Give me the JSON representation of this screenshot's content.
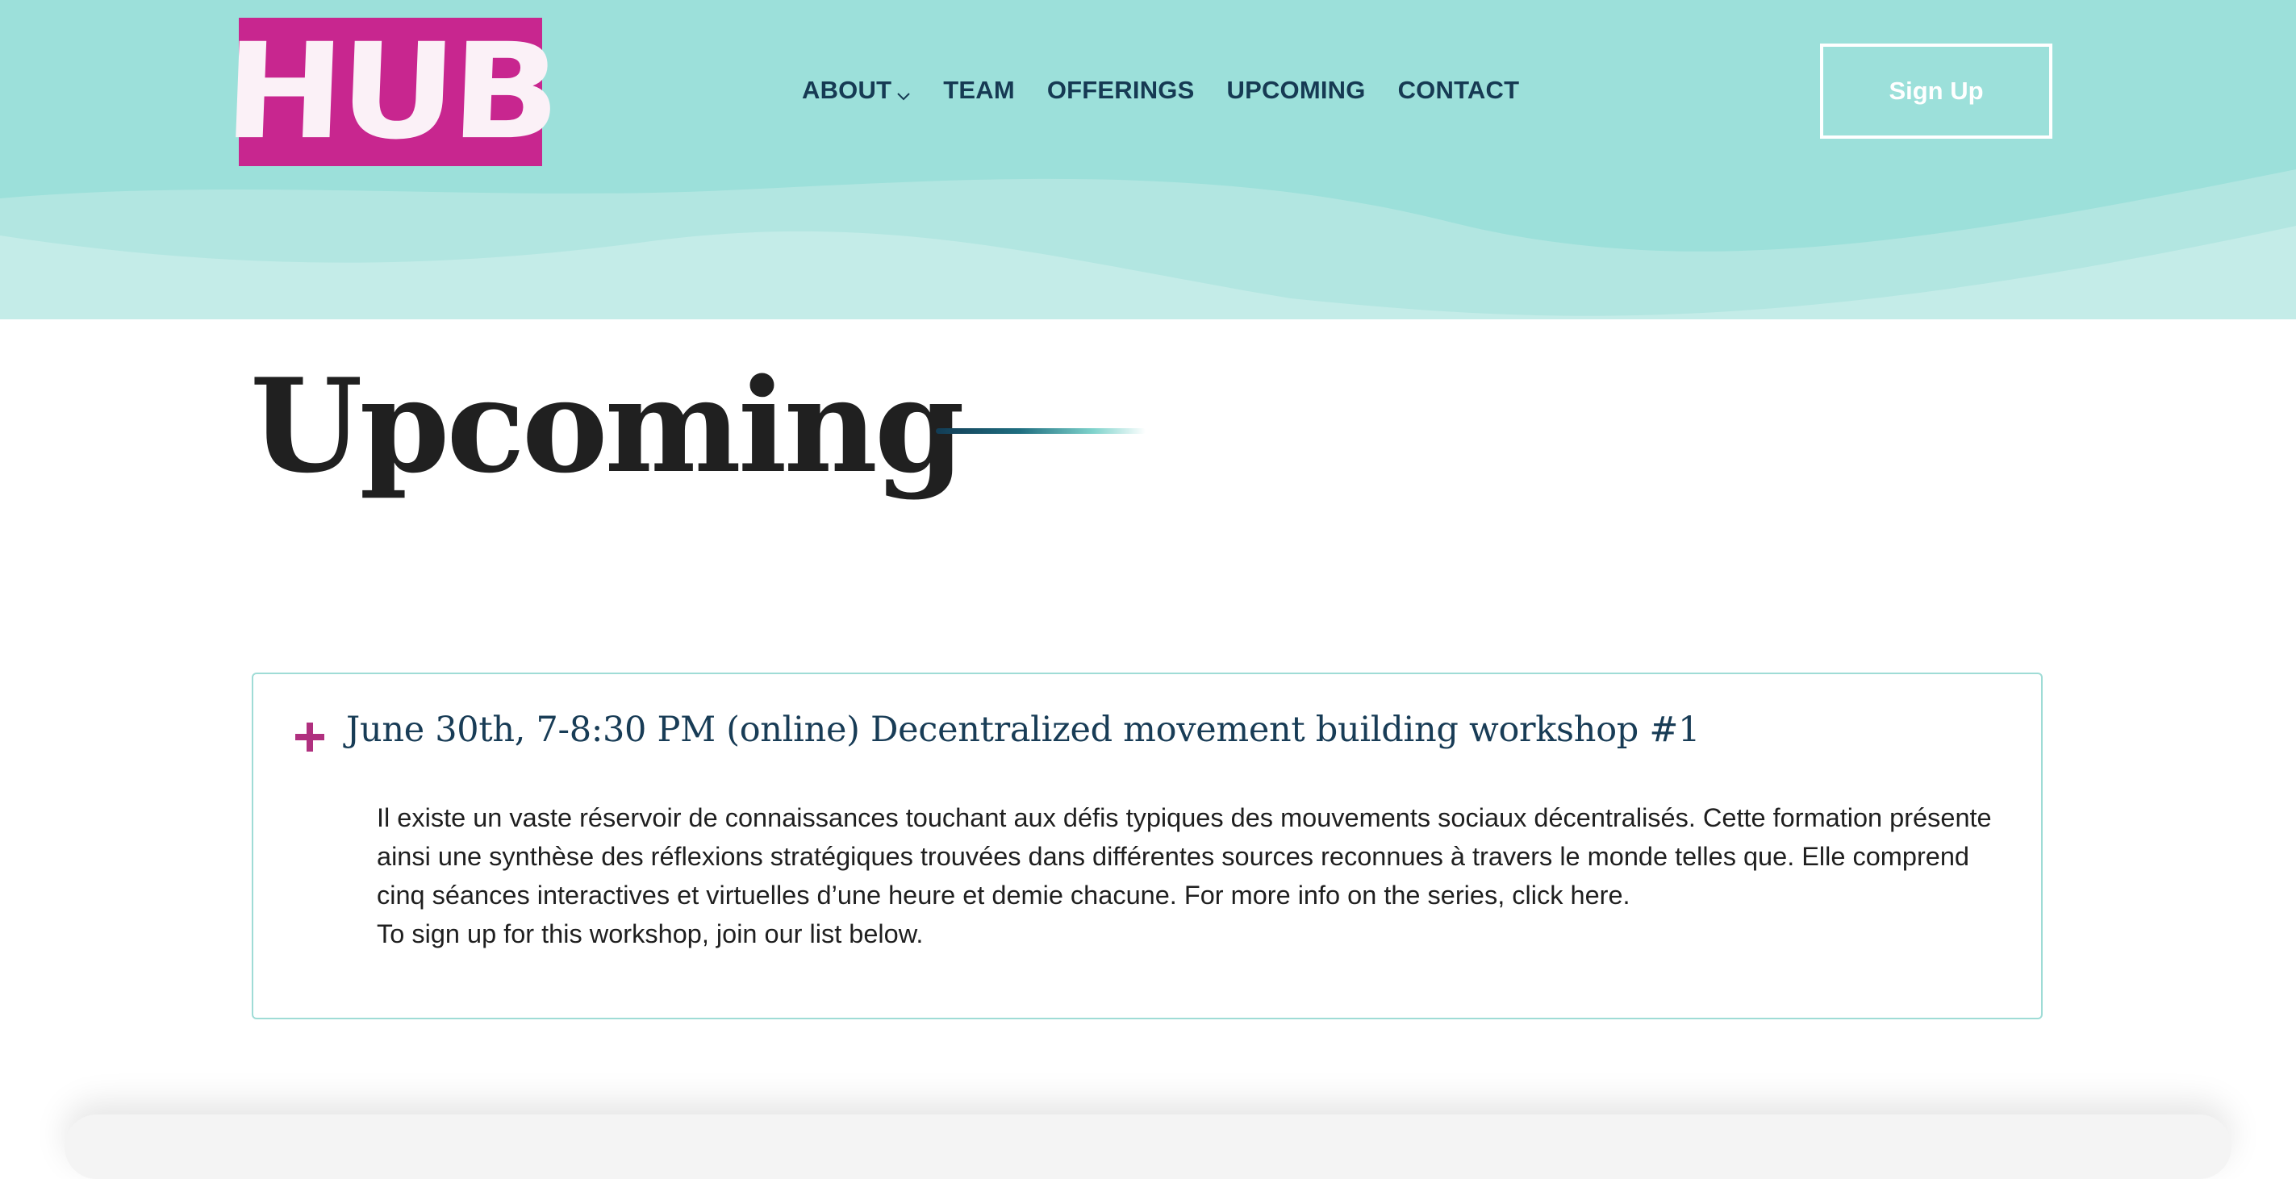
{
  "header": {
    "logo_text": "HUB",
    "nav": {
      "about": "ABOUT",
      "team": "TEAM",
      "offerings": "OFFERINGS",
      "upcoming": "UPCOMING",
      "contact": "CONTACT"
    },
    "signup_label": "Sign Up"
  },
  "page": {
    "title": "Upcoming"
  },
  "event": {
    "title": "June 30th, 7-8:30 PM (online) Decentralized movement building workshop #1",
    "description": "Il existe un vaste réservoir de connaissances touchant aux défis typiques des mouvements sociaux décentralisés. Cette formation présente ainsi une synthèse des réflexions stratégiques trouvées dans différentes sources reconnues à travers le monde telles que. Elle comprend cinq séances interactives et virtuelles d’une heure et demie chacune. For more info on the series, click here.",
    "signup_note": "To sign up for this workshop, join our list below.",
    "expand_icon": "plus-icon"
  },
  "colors": {
    "header_bg": "#9ce0da",
    "logo_bg": "#c8268f",
    "nav_text": "#163a53",
    "accent": "#b0307f",
    "card_border": "#9fdcd6"
  }
}
